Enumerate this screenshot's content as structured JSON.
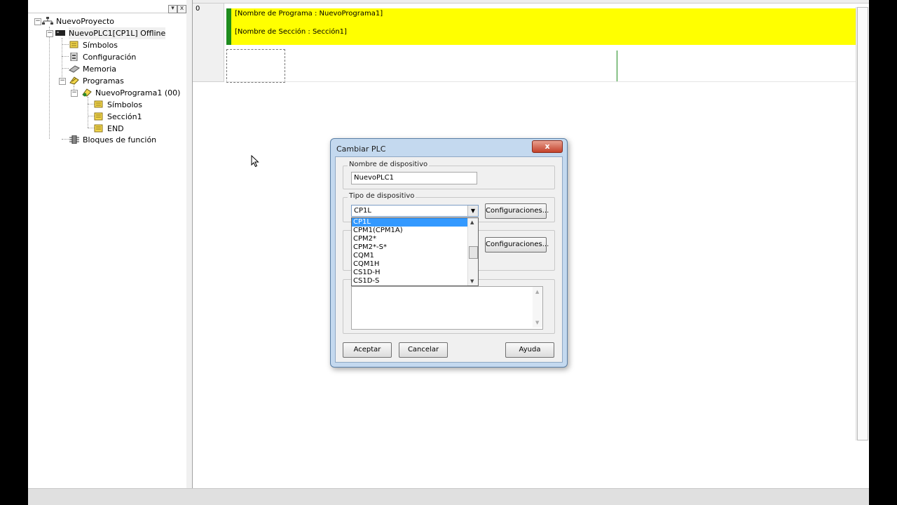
{
  "tree": {
    "items": [
      {
        "label": "NuevoProyecto",
        "icon": "network-icon"
      },
      {
        "label": "NuevoPLC1[CP1L] Offline",
        "icon": "plc-icon"
      },
      {
        "label": "Símbolos",
        "icon": "symbols-icon"
      },
      {
        "label": "Configuración",
        "icon": "settings-icon"
      },
      {
        "label": "Memoria",
        "icon": "memory-icon"
      },
      {
        "label": "Programas",
        "icon": "programs-icon"
      },
      {
        "label": "NuevoPrograma1 (00)",
        "icon": "program-icon"
      },
      {
        "label": "Símbolos",
        "icon": "symbols-icon"
      },
      {
        "label": "Sección1",
        "icon": "section-icon"
      },
      {
        "label": "END",
        "icon": "section-icon"
      },
      {
        "label": "Bloques de función",
        "icon": "function-block-icon"
      }
    ],
    "expand_glyph": "−",
    "dropdown_glyph": "▾",
    "close_glyph": "x"
  },
  "ladder": {
    "rung_number": "0",
    "program_name": "[Nombre de Programa : NuevoPrograma1]",
    "section_name": "[Nombre de Sección : Sección1]"
  },
  "dialog": {
    "title": "Cambiar PLC",
    "close_glyph": "x",
    "device_name_group": "Nombre de dispositivo",
    "device_name_value": "NuevoPLC1",
    "device_type_group": "Tipo de dispositivo",
    "device_type_value": "CP1L",
    "combo_arrow": "▼",
    "settings_button_1": "Configuraciones...",
    "settings_button_2": "Configuraciones...",
    "options": [
      "CP1L",
      "CPM1(CPM1A)",
      "CPM2*",
      "CPM2*-S*",
      "CQM1",
      "CQM1H",
      "CS1D-H",
      "CS1D-S"
    ],
    "scroll_up": "▲",
    "scroll_down": "▼",
    "accept": "Aceptar",
    "cancel": "Cancelar",
    "help": "Ayuda"
  },
  "colors": {
    "header_yellow": "#ffff00",
    "rail_green": "#1e8c1e",
    "selection_blue": "#3399ff",
    "close_red": "#c4422b"
  }
}
